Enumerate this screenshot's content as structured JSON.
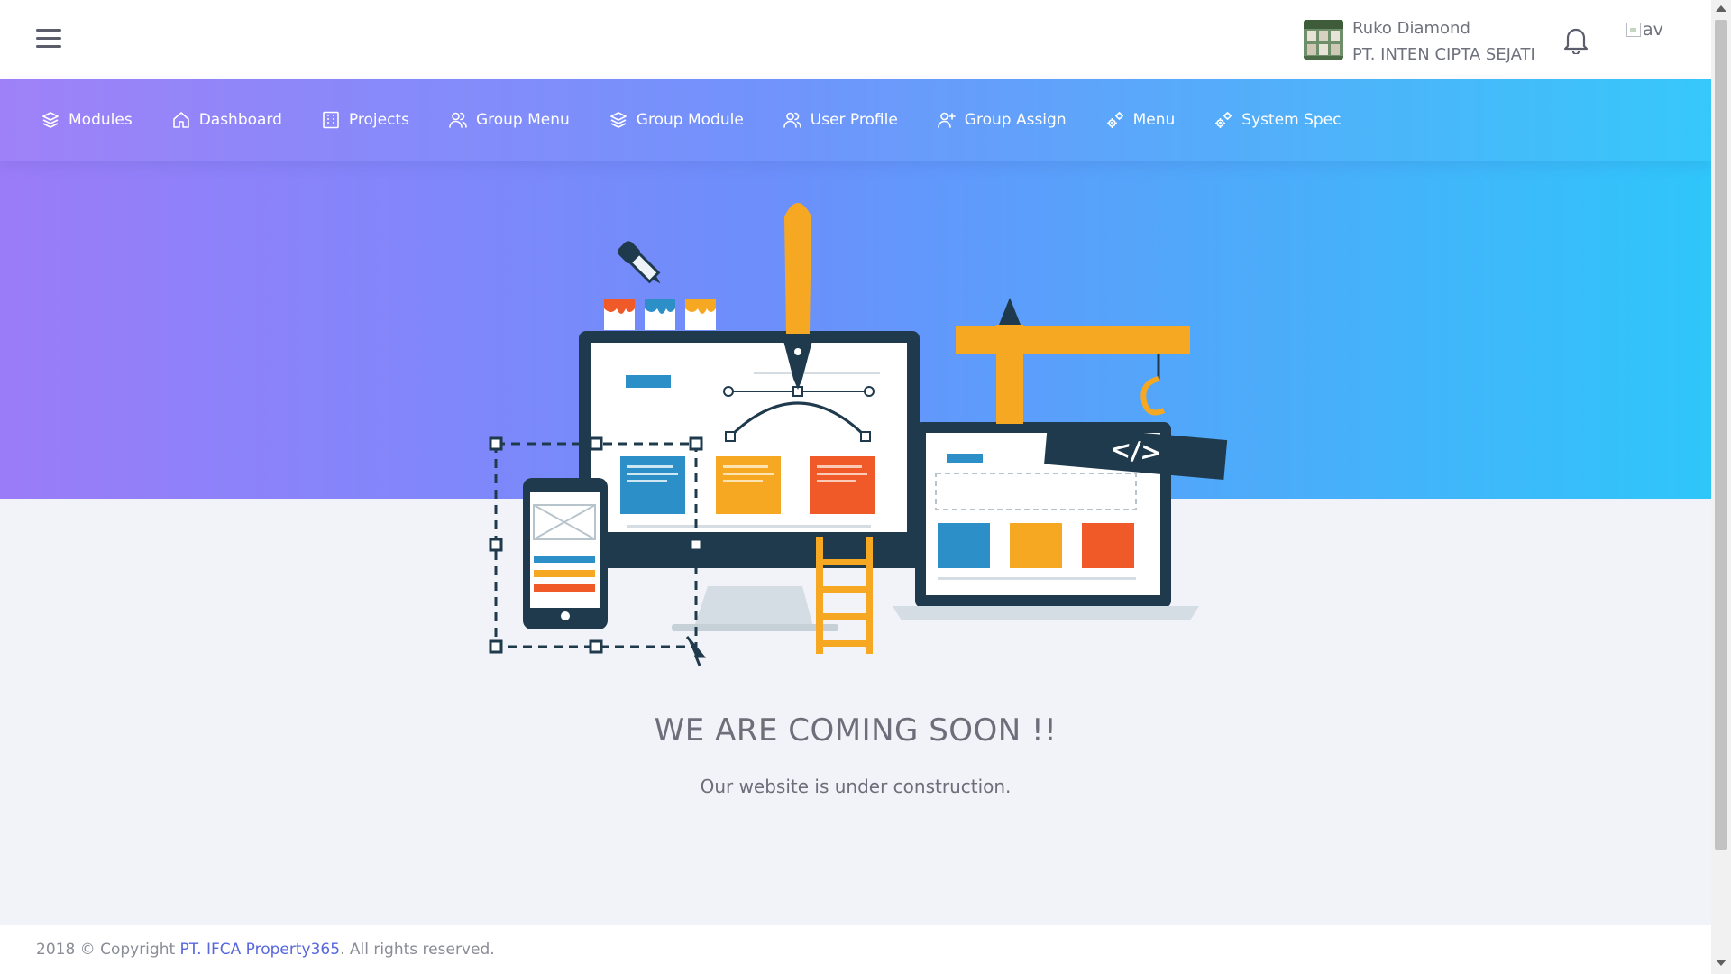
{
  "header": {
    "project_name": "Ruko Diamond",
    "company_name": "PT. INTEN CIPTA SEJATI",
    "avatar_alt": "av"
  },
  "nav": {
    "items": [
      {
        "label": "Modules",
        "icon": "layers-icon"
      },
      {
        "label": "Dashboard",
        "icon": "home-icon"
      },
      {
        "label": "Projects",
        "icon": "building-icon"
      },
      {
        "label": "Group Menu",
        "icon": "users-icon"
      },
      {
        "label": "Group Module",
        "icon": "layers-icon"
      },
      {
        "label": "User Profile",
        "icon": "users-icon"
      },
      {
        "label": "Group Assign",
        "icon": "user-add-icon"
      },
      {
        "label": "Menu",
        "icon": "gears-icon"
      },
      {
        "label": "System Spec",
        "icon": "gears-icon"
      }
    ]
  },
  "main": {
    "headline": "WE ARE COMING SOON !!",
    "subline": "Our website is under construction.",
    "illustration_code_tag": "</>"
  },
  "footer": {
    "prefix": "2018 © Copyright ",
    "link_text": "PT. IFCA Property365",
    "suffix": ". All rights reserved."
  },
  "colors": {
    "gradient_start": "#9b7cf8",
    "gradient_end": "#2fc6fa",
    "accent_link": "#5867dd"
  }
}
